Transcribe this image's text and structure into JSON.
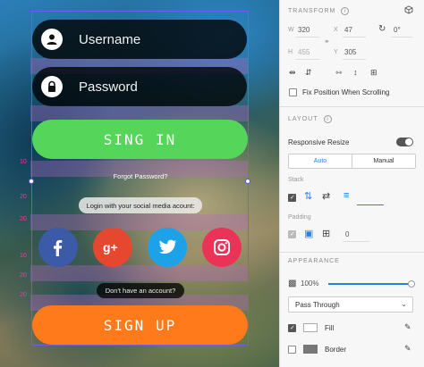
{
  "canvas": {
    "username_placeholder": "Username",
    "password_placeholder": "Password",
    "signin_label": "SING IN",
    "forgot_label": "Forgot Password?",
    "social_prompt": "Login with your social media acount:",
    "no_account_label": "Don't have an account?",
    "signup_label": "SIGN UP",
    "social": {
      "facebook": "f",
      "google": "g+",
      "twitter": "t",
      "instagram": "ig"
    },
    "guides": [
      "10",
      "20",
      "20",
      "10",
      "20",
      "20"
    ],
    "colors": {
      "signin_bg": "#55d65a",
      "signin_text": "#ffffff",
      "signup_bg": "#ff7a1a",
      "signup_text": "#ffffff",
      "facebook": "#3b5aa8",
      "google": "#e5482f",
      "twitter": "#1da1e8",
      "instagram": "#ea3356",
      "selection": "#7a5aff",
      "guide": "#e040a0"
    }
  },
  "inspector": {
    "transform": {
      "title": "TRANSFORM",
      "w_label": "W",
      "w_value": "320",
      "x_label": "X",
      "x_value": "47",
      "rotation_value": "0°",
      "h_label": "H",
      "h_value": "455",
      "y_label": "Y",
      "y_value": "305",
      "fix_position_label": "Fix Position When Scrolling"
    },
    "layout": {
      "title": "LAYOUT",
      "responsive_resize_label": "Responsive Resize",
      "responsive_resize_on": true,
      "mode_auto": "Auto",
      "mode_manual": "Manual",
      "stack_label": "Stack",
      "stack_value": "",
      "padding_label": "Padding",
      "padding_value": "0"
    },
    "appearance": {
      "title": "APPEARANCE",
      "opacity_value": "100%",
      "opacity_level": 1.0,
      "blend_mode": "Pass Through",
      "fill_label": "Fill",
      "border_label": "Border"
    }
  }
}
